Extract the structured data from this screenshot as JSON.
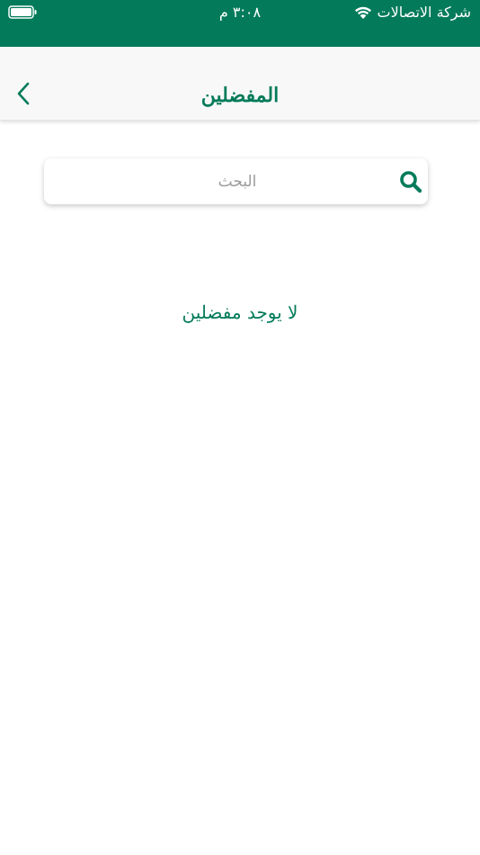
{
  "status_bar": {
    "carrier": "شركة الاتصالات",
    "time": "٣:٠٨ م"
  },
  "nav": {
    "title": "المفضلين",
    "back_icon": "chevron-left-icon"
  },
  "search": {
    "placeholder": "البحث",
    "value": "",
    "icon": "search-icon"
  },
  "content": {
    "empty_message": "لا يوجد مفضلين"
  },
  "colors": {
    "primary": "#037b5a",
    "nav_background": "#f8f8f8",
    "placeholder": "#9b9b9b"
  }
}
